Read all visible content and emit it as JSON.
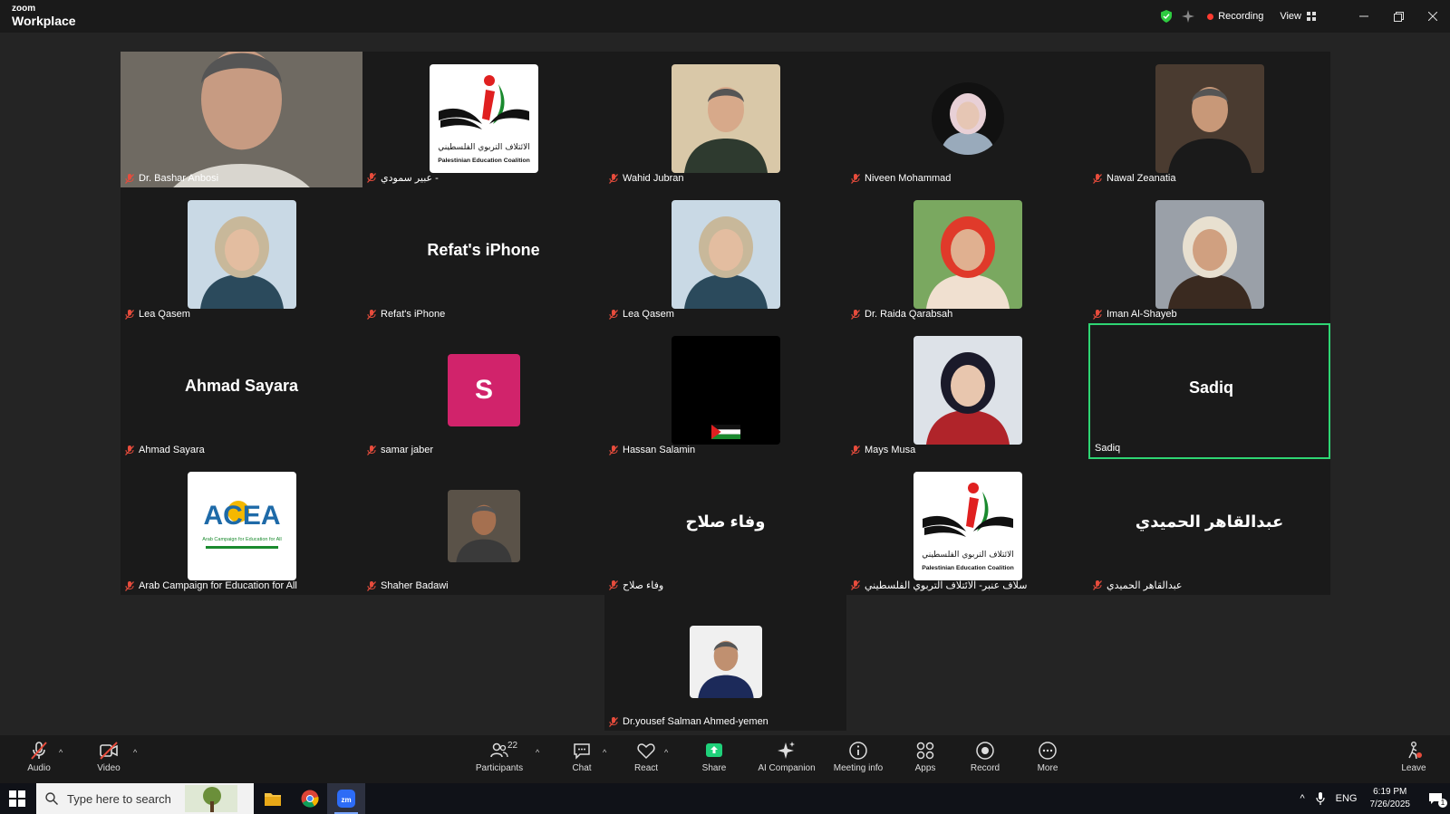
{
  "window": {
    "brand_top": "zoom",
    "brand_bottom": "Workplace",
    "recording_label": "Recording",
    "view_label": "View"
  },
  "participants": [
    {
      "name": "Dr. Bashar Anbosi",
      "kind": "video"
    },
    {
      "name": "عبير سمودي -",
      "kind": "logo"
    },
    {
      "name": "Wahid Jubran",
      "kind": "photo"
    },
    {
      "name": "Niveen Mohammad",
      "kind": "photo-small"
    },
    {
      "name": "Nawal Zeanatia",
      "kind": "photo"
    },
    {
      "name": "Lea Qasem",
      "kind": "photo"
    },
    {
      "name": "Refat's iPhone",
      "kind": "text",
      "big": "Refat's iPhone"
    },
    {
      "name": "Lea Qasem",
      "kind": "photo"
    },
    {
      "name": "Dr. Raida Qarabsah",
      "kind": "photo"
    },
    {
      "name": "Iman Al-Shayeb",
      "kind": "photo"
    },
    {
      "name": "Ahmad Sayara",
      "kind": "text",
      "big": "Ahmad Sayara"
    },
    {
      "name": "samar jaber",
      "kind": "initial",
      "big": "S"
    },
    {
      "name": "Hassan Salamin",
      "kind": "black"
    },
    {
      "name": "Mays Musa",
      "kind": "photo"
    },
    {
      "name": "Sadiq",
      "kind": "text",
      "big": "Sadiq",
      "active": true
    },
    {
      "name": "Arab Campaign for Education for All",
      "kind": "logo2",
      "logo_text": "ACEA",
      "logo_sub": "Arab Campaign for Education for All"
    },
    {
      "name": "Shaher Badawi",
      "kind": "photo-small"
    },
    {
      "name": "وفاء صلاح",
      "kind": "text",
      "big": "وفاء صلاح"
    },
    {
      "name": "سلاف عنبر- الائتلاف التربوي الفلسطيني",
      "kind": "logo"
    },
    {
      "name": "عبدالقاهر الحميدي",
      "kind": "text",
      "big": "عبدالقاهر الحميدي"
    },
    {
      "name": "Dr.yousef Salman Ahmed-yemen",
      "kind": "photo-small"
    }
  ],
  "coalition_logo": {
    "arabic": "الائتلاف التربوي الفلسطيني",
    "english": "Palestinian Education Coalition"
  },
  "toolbar": {
    "audio": "Audio",
    "video": "Video",
    "participants": "Participants",
    "participants_count": "22",
    "chat": "Chat",
    "react": "React",
    "share": "Share",
    "ai": "AI Companion",
    "meeting_info": "Meeting info",
    "apps": "Apps",
    "record": "Record",
    "more": "More",
    "leave": "Leave"
  },
  "taskbar": {
    "search_placeholder": "Type here to search",
    "lang": "ENG",
    "time": "6:19 PM",
    "date": "7/26/2025",
    "notif_count": "1"
  },
  "colors": {
    "active_border": "#2ed573",
    "initial_bg": "#d1236b",
    "share_green": "#1fd17a",
    "record_dot": "#ff3b30"
  }
}
